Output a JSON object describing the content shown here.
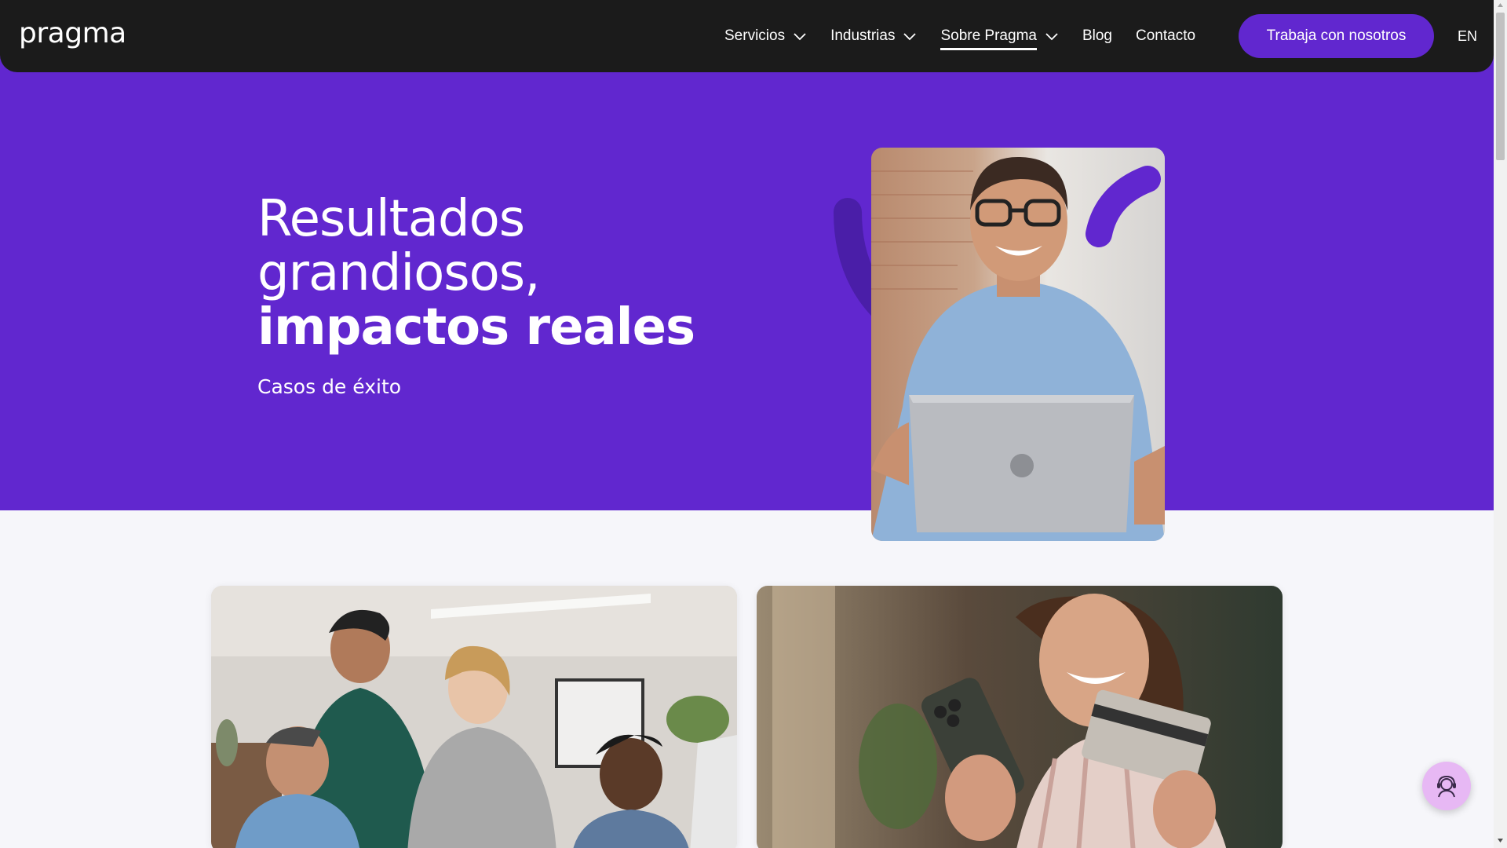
{
  "brand": {
    "logo_text": "pragma"
  },
  "nav": {
    "items": [
      {
        "label": "Servicios",
        "has_dropdown": true
      },
      {
        "label": "Industrias",
        "has_dropdown": true
      },
      {
        "label": "Sobre Pragma",
        "has_dropdown": true,
        "active": true
      },
      {
        "label": "Blog",
        "has_dropdown": false
      },
      {
        "label": "Contacto",
        "has_dropdown": false
      }
    ],
    "cta_label": "Trabaja con nosotros",
    "language": "EN"
  },
  "hero": {
    "title_line1": "Resultados",
    "title_line2": "grandiosos,",
    "title_bold": "impactos reales",
    "subtitle": "Casos de éxito"
  },
  "colors": {
    "brand_purple": "#6127cf",
    "nav_bg": "#1b1b1b",
    "arc_purple": "#4a1ea8",
    "fab_bg": "#e7b8f4",
    "page_bg": "#f6f6fa"
  },
  "icons": {
    "dropdown": "chevron-down-icon",
    "help": "support-agent-icon"
  }
}
